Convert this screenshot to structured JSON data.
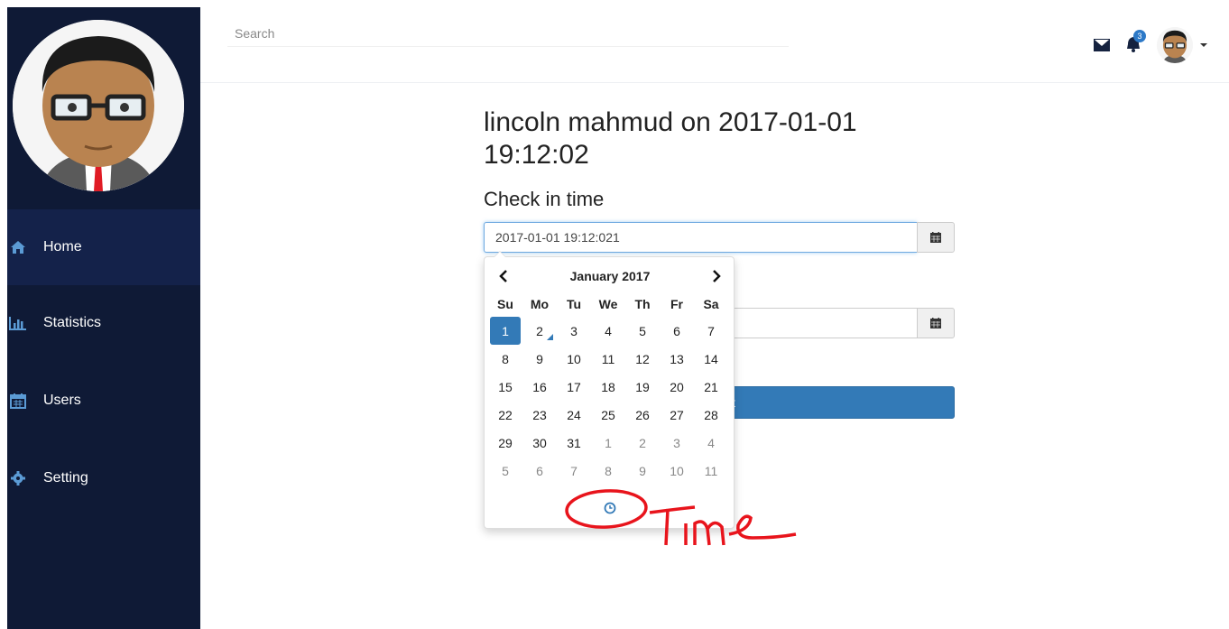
{
  "sidebar": {
    "items": [
      {
        "label": "Home",
        "icon": "home-icon",
        "active": true
      },
      {
        "label": "Statistics",
        "icon": "bar-chart-icon"
      },
      {
        "label": "Users",
        "icon": "calendar-icon"
      },
      {
        "label": "Setting",
        "icon": "gear-icon"
      }
    ]
  },
  "topbar": {
    "search_placeholder": "Search",
    "notification_count": "3"
  },
  "main": {
    "title": "lincoln mahmud on 2017-01-01 19:12:02",
    "checkin_label": "Check in time",
    "checkin_value": "2017-01-01 19:12:021",
    "checkout_value": "",
    "submit_label": "t"
  },
  "datepicker": {
    "month_label": "January 2017",
    "prev": "‹",
    "next": "›",
    "weekdays": [
      "Su",
      "Mo",
      "Tu",
      "We",
      "Th",
      "Fr",
      "Sa"
    ],
    "weeks": [
      [
        "1",
        "2",
        "3",
        "4",
        "5",
        "6",
        "7"
      ],
      [
        "8",
        "9",
        "10",
        "11",
        "12",
        "13",
        "14"
      ],
      [
        "15",
        "16",
        "17",
        "18",
        "19",
        "20",
        "21"
      ],
      [
        "22",
        "23",
        "24",
        "25",
        "26",
        "27",
        "28"
      ],
      [
        "29",
        "30",
        "31",
        "1",
        "2",
        "3",
        "4"
      ],
      [
        "5",
        "6",
        "7",
        "8",
        "9",
        "10",
        "11"
      ]
    ],
    "selected_day": "1",
    "today_day": "2"
  },
  "annotation": {
    "handwritten_text": "Time",
    "color": "#e8141c"
  },
  "colors": {
    "sidebar_bg": "#0f1a36",
    "accent": "#337ab7"
  }
}
